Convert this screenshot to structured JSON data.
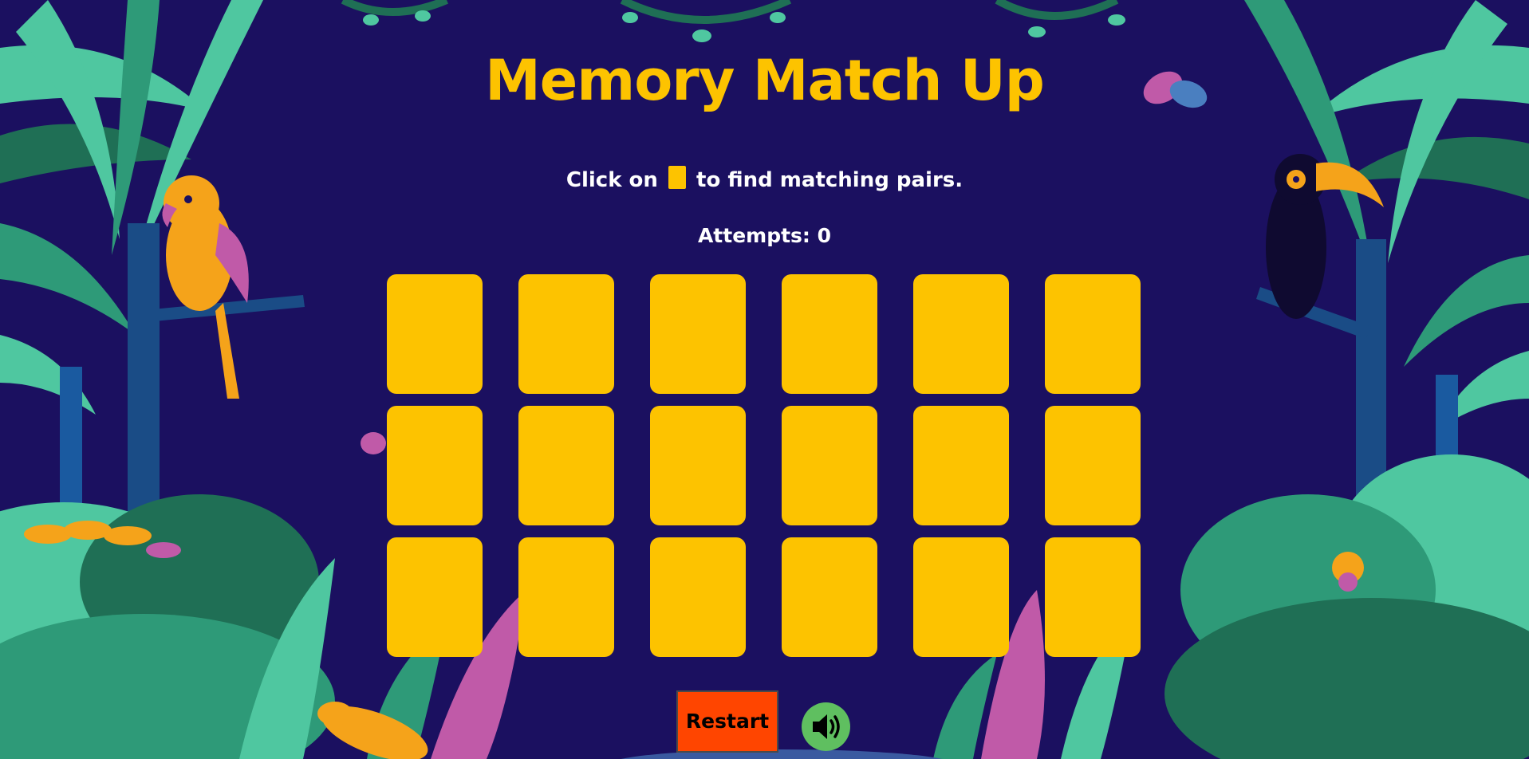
{
  "game": {
    "title": "Memory Match Up",
    "instructions_before": "Click on",
    "instructions_after": "to find matching pairs.",
    "attempts_label": "Attempts: ",
    "attempts_value": "0",
    "restart_label": "Restart",
    "sound_icon": "speaker-volume-icon"
  },
  "board": {
    "rows": 3,
    "columns": 6,
    "card_count": 18,
    "face_down_color": "#fdc300"
  },
  "colors": {
    "background": "#1b1060",
    "accent_yellow": "#fdc300",
    "restart_red": "#ff4500",
    "sound_green": "#5fbf60",
    "leaf_mint": "#4fc7a0",
    "leaf_dark": "#1f6f55",
    "flower_pink": "#c05aa8"
  }
}
